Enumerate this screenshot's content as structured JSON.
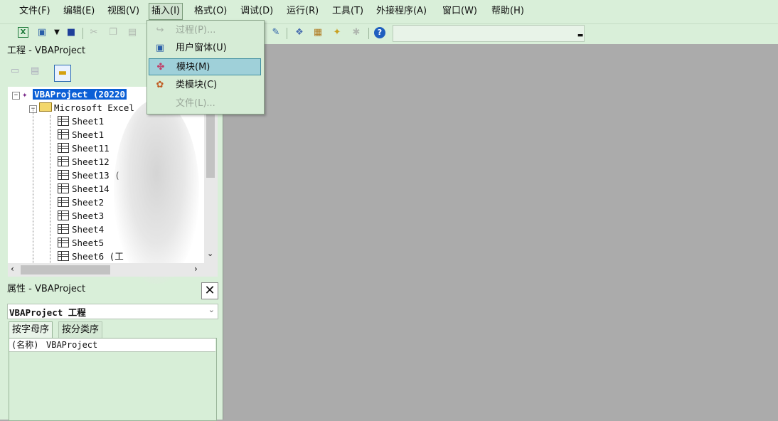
{
  "menubar": {
    "items": [
      "文件(F)",
      "编辑(E)",
      "视图(V)",
      "插入(I)",
      "格式(O)",
      "调试(D)",
      "运行(R)",
      "工具(T)",
      "外接程序(A)",
      "窗口(W)",
      "帮助(H)"
    ]
  },
  "toolbar": {
    "icons": [
      "excel-view-icon",
      "insert-object-icon",
      "dropdown-arrow-icon",
      "save-icon",
      "cut-icon",
      "copy-icon",
      "paste-icon",
      "design-mode-icon",
      "project-explorer-icon",
      "properties-icon",
      "object-browser-icon",
      "toolbox-icon",
      "help-icon"
    ]
  },
  "insert_menu": {
    "items": [
      {
        "label": "过程(P)...",
        "icon": "procedure-icon",
        "enabled": false
      },
      {
        "label": "用户窗体(U)",
        "icon": "userform-icon",
        "enabled": true
      },
      {
        "label": "模块(M)",
        "icon": "module-icon",
        "enabled": true,
        "selected": true
      },
      {
        "label": "类模块(C)",
        "icon": "class-module-icon",
        "enabled": true
      },
      {
        "label": "文件(L)...",
        "icon": "",
        "enabled": false
      }
    ]
  },
  "project_panel": {
    "title": "工程 - VBAProject",
    "root_label": "VBAProject (20220",
    "folder_label": "Microsoft Excel",
    "sheets": [
      "Sheet1",
      "Sheet1",
      "Sheet11",
      "Sheet12",
      "Sheet13 (",
      "Sheet14",
      "Sheet2",
      "Sheet3",
      "Sheet4",
      "Sheet5",
      "Sheet6 (工"
    ]
  },
  "properties_panel": {
    "title": "属性 - VBAProject",
    "close_label": "✕",
    "object_label": "VBAProject 工程",
    "tab_alpha": "按字母序",
    "tab_category": "按分类序",
    "row_key": "(名称)",
    "row_value": "VBAProject"
  },
  "colors": {
    "chrome": "#d9efd9",
    "workspace": "#ababab",
    "selection": "#0b5fd6",
    "menu_highlight": "#9fd0d9"
  }
}
